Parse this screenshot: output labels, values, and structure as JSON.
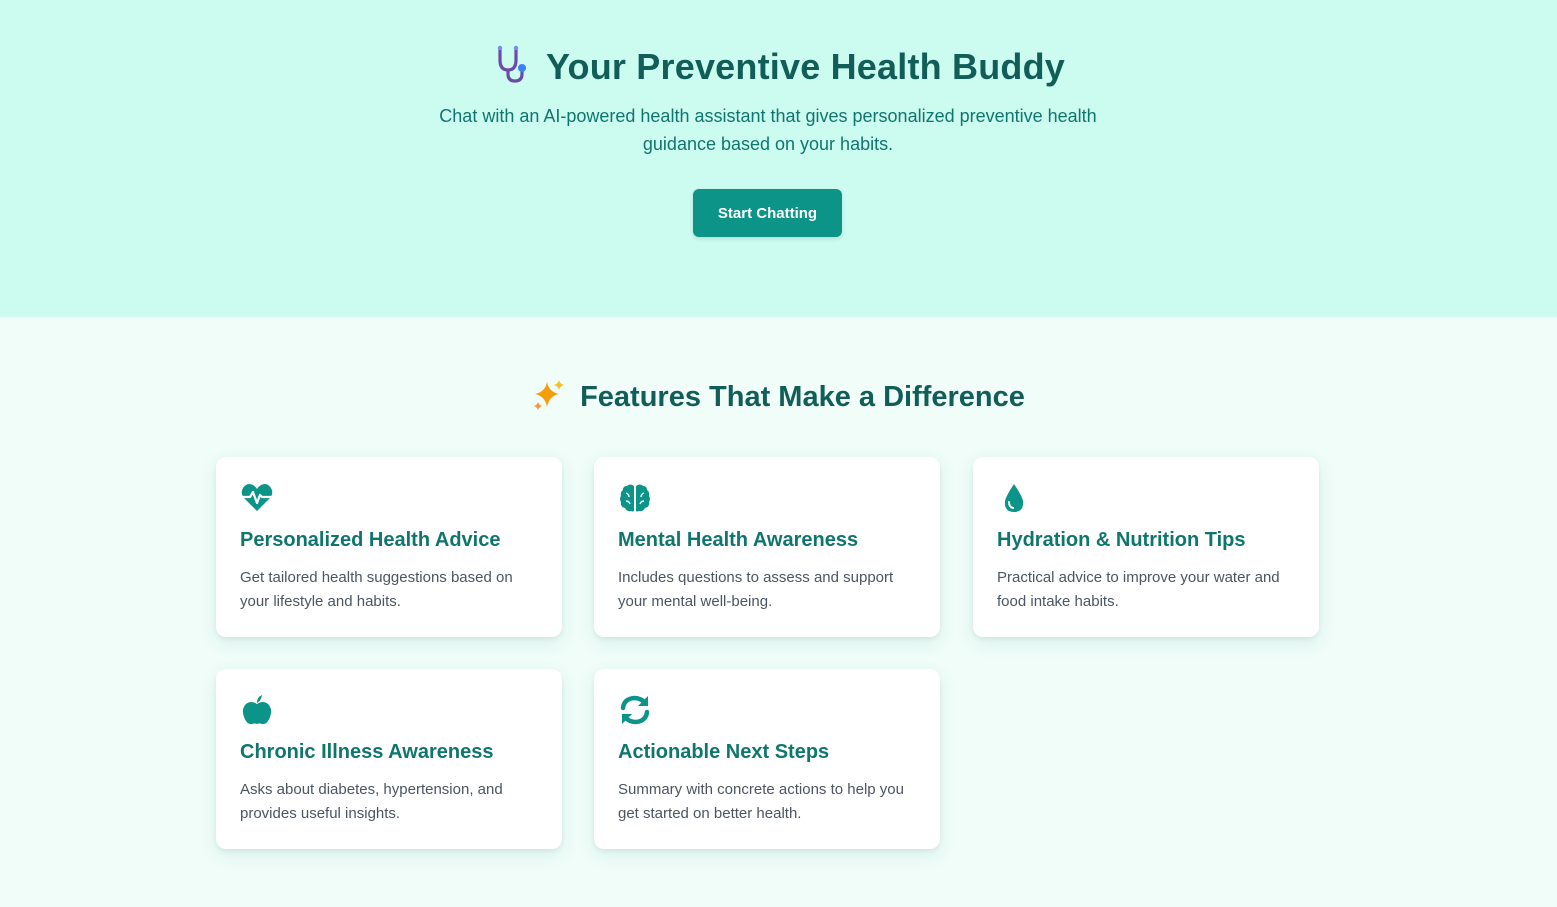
{
  "hero": {
    "title": "Your Preventive Health Buddy",
    "icon": "stethoscope-icon",
    "subtitle": "Chat with an AI-powered health assistant that gives personalized preventive health guidance based on your habits.",
    "cta_label": "Start Chatting"
  },
  "features": {
    "title": "Features That Make a Difference",
    "icon": "sparkles-icon",
    "cards": [
      {
        "icon": "heartbeat-icon",
        "title": "Personalized Health Advice",
        "text": "Get tailored health suggestions based on your lifestyle and habits."
      },
      {
        "icon": "brain-icon",
        "title": "Mental Health Awareness",
        "text": "Includes questions to assess and support your mental well-being."
      },
      {
        "icon": "water-drop-icon",
        "title": "Hydration & Nutrition Tips",
        "text": "Practical advice to improve your water and food intake habits."
      },
      {
        "icon": "apple-icon",
        "title": "Chronic Illness Awareness",
        "text": "Asks about diabetes, hypertension, and provides useful insights."
      },
      {
        "icon": "refresh-icon",
        "title": "Actionable Next Steps",
        "text": "Summary with concrete actions to help you get started on better health."
      }
    ]
  },
  "colors": {
    "hero_bg": "#ccfbf0",
    "page_bg": "#f0fdf9",
    "accent": "#0d9488",
    "heading": "#115e59"
  }
}
